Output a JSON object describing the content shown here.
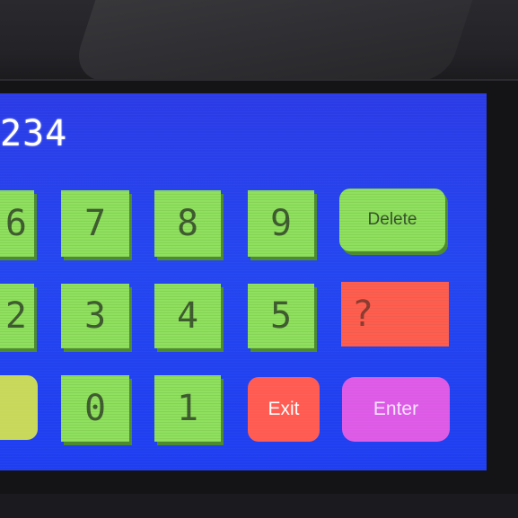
{
  "display": {
    "value": "234"
  },
  "keypad": {
    "row1": [
      "6",
      "7",
      "8",
      "9"
    ],
    "row2": [
      "2",
      "3",
      "4",
      "5"
    ],
    "row3": [
      "",
      "0",
      "1"
    ]
  },
  "buttons": {
    "delete_label": "Delete",
    "help_label": "?",
    "exit_label": "Exit",
    "enter_label": "Enter"
  },
  "colors": {
    "screen": "#2446f0",
    "digit_key": "#8ee05c",
    "help_key": "#ff5e4e",
    "exit_key": "#ff5b52",
    "enter_key": "#dd5ae6",
    "left_key": "#c8d85a"
  }
}
